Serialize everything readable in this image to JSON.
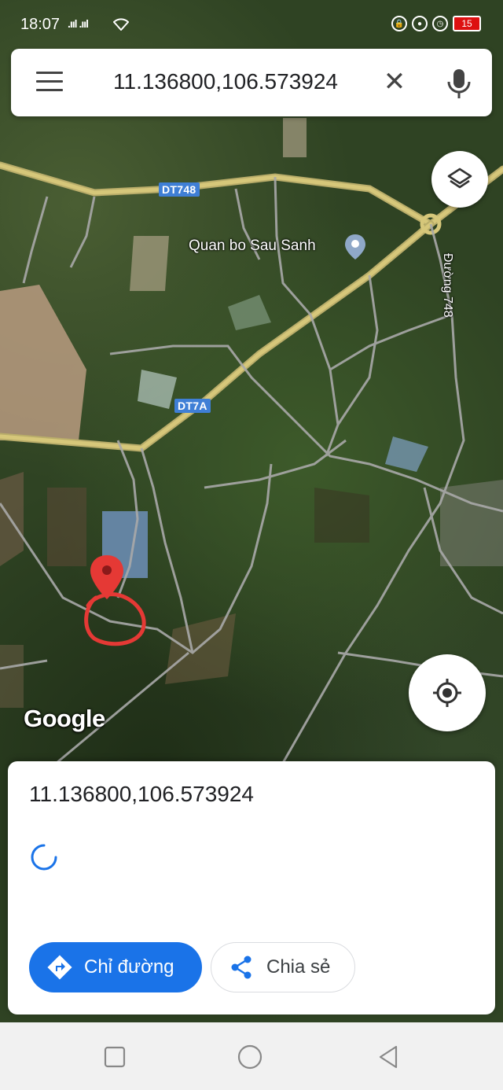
{
  "status_bar": {
    "time": "18:07",
    "signal": ".ııl .ııl",
    "battery": "15"
  },
  "search": {
    "value": "11.136800,106.573924",
    "clear_glyph": "✕"
  },
  "map": {
    "road_labels": [
      "DT748",
      "DT7A"
    ],
    "place_label": "Quan bo Sau Sanh",
    "vertical_road_name": "Đường 748",
    "logo": "Google",
    "pin_color": "#e53935",
    "annotation_color": "#e53935"
  },
  "sheet": {
    "title": "11.136800,106.573924",
    "directions_label": "Chỉ đường",
    "share_label": "Chia sẻ"
  },
  "colors": {
    "accent": "#1a73e8"
  }
}
